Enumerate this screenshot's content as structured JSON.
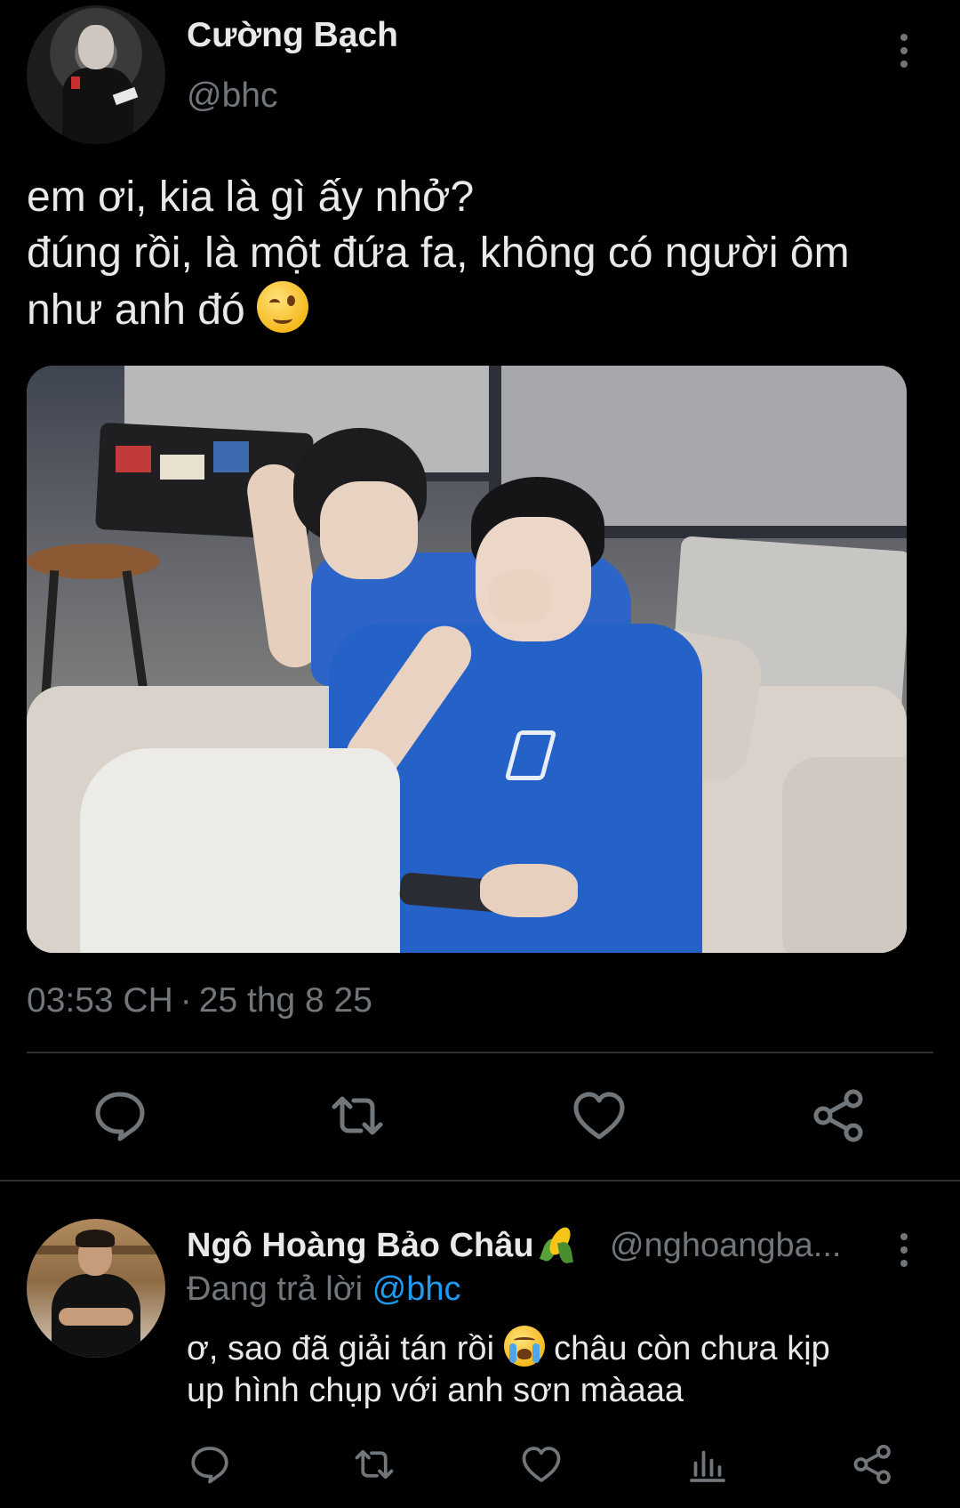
{
  "main_tweet": {
    "author_name": "Cường Bạch",
    "author_handle": "@bhc",
    "text_lines": [
      "em ơi, kia là gì ấy nhở?",
      "đúng rồi, là một đứa fa, không có người ôm",
      "như anh đó"
    ],
    "text_emoji": "winking-face",
    "time": "03:53 CH",
    "separator": "·",
    "date": "25 thg 8 25",
    "actions": [
      "reply-icon",
      "retweet-icon",
      "like-icon",
      "share-icon"
    ]
  },
  "reply_tweet": {
    "author_name": "Ngô Hoàng Bảo Châu",
    "name_emoji": "corn",
    "author_handle": "@nghoangba...",
    "replying_prefix": "Đang trả lời",
    "replying_to": "@bhc",
    "text_line1_a": "ơ, sao đã giải tán rồi",
    "text_line1_emoji": "loudly-crying-face",
    "text_line1_b": "châu còn chưa kịp",
    "text_line2": "up hình chụp với anh sơn màaaa",
    "actions": [
      "reply-icon",
      "retweet-icon",
      "like-icon",
      "views-icon",
      "share-icon"
    ]
  },
  "colors": {
    "background": "#000000",
    "text_primary": "#e7e9ea",
    "text_secondary": "#71767b",
    "link": "#1d9bf0",
    "divider": "#2f3336"
  }
}
